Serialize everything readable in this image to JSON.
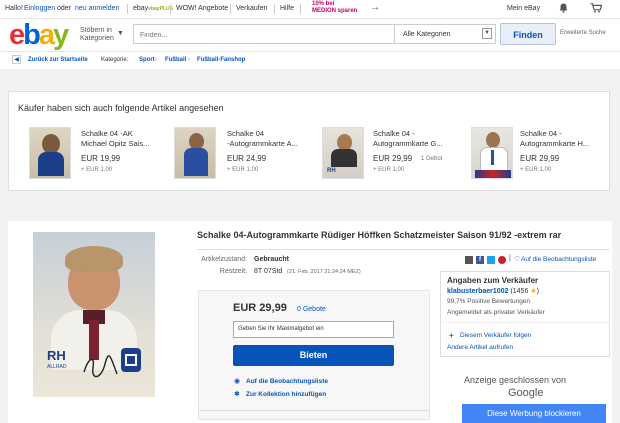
{
  "topbar": {
    "greeting": "Hallo!",
    "login": "Einloggen",
    "or": "oder",
    "register": "neu anmelden",
    "ebayplus": "ebayPLUS",
    "wow": "WOW! Angebote",
    "sell": "Verkaufen",
    "help": "Hilfe",
    "promo_line1": "10% bei",
    "promo_line2": "MEDION sparen",
    "my_ebay": "Mein eBay"
  },
  "header": {
    "logo": [
      "e",
      "b",
      "a",
      "y"
    ],
    "logo_colors": [
      "#e53238",
      "#0064d2",
      "#f5af02",
      "#86b817"
    ],
    "browse_line1": "Stöbern in",
    "browse_line2": "Kategorien",
    "search_placeholder": "Finden...",
    "category": "Alle Kategorien",
    "find_button": "Finden",
    "advanced": "Erweiterte Suche"
  },
  "breadcrumb": {
    "back": "Zurück zur Startseite",
    "category_label": "Kategorie:",
    "items": [
      "Sport",
      "Fußball",
      "Fußball-Fanshop"
    ]
  },
  "related": {
    "title": "Käufer haben sich auch folgende Artikel angesehen",
    "items": [
      {
        "title_1": "Schalke 04 -AK",
        "title_2": "Michael Opitz Sais...",
        "price": "EUR 19,99",
        "bids": "",
        "shipping": "+ EUR 1,00"
      },
      {
        "title_1": "Schalke 04",
        "title_2": "-Autogrammkarte A...",
        "price": "EUR 24,99",
        "bids": "",
        "shipping": "+ EUR 1,00"
      },
      {
        "title_1": "Schalke 04 -",
        "title_2": "Autogrammkarte G...",
        "price": "EUR 29,99",
        "bids": "1 Gebot",
        "shipping": "+ EUR 1,00"
      },
      {
        "title_1": "Schalke 04 -",
        "title_2": "Autogrammkarte H...",
        "price": "EUR 29,99",
        "bids": "",
        "shipping": "+ EUR 1,00"
      }
    ]
  },
  "item": {
    "title": "Schalke 04-Autogrammkarte Rüdiger Höffken Schatzmeister Saison 91/92 -extrem rar",
    "condition_label": "Artikelzustand:",
    "condition": "Gebraucht",
    "remaining_label": "Restzeit:",
    "remaining": "8T 07Std",
    "end_date": "(21. Feb. 2017  21:24:24 MEZ)",
    "price": "EUR 29,99",
    "bids": "0 Gebote",
    "bid_placeholder": "Geben Sie Ihr Maximalgebot ein",
    "bid_button": "Bieten",
    "watch": "Auf die Beobachtungsliste",
    "collection": "Zur Kollektion hinzufügen",
    "share_watch": "Auf die Beobachtungsliste"
  },
  "photo": {
    "logo_text": "RH",
    "logo_sub": "ALLRAD"
  },
  "seller": {
    "heading": "Angaben zum Verkäufer",
    "name": "klabusterbaer1002",
    "score": "(1456",
    "score_close": ")",
    "positive": "99,7% Positive Bewertungen",
    "type": "Angemeldet als privater Verkäufer",
    "follow": "Diesem Verkäufer folgen",
    "other_items": "Andere Artikel aufrufen"
  },
  "ad": {
    "closed": "Anzeige geschlossen von",
    "google": "Google",
    "block": "Diese Werbung blockieren"
  }
}
